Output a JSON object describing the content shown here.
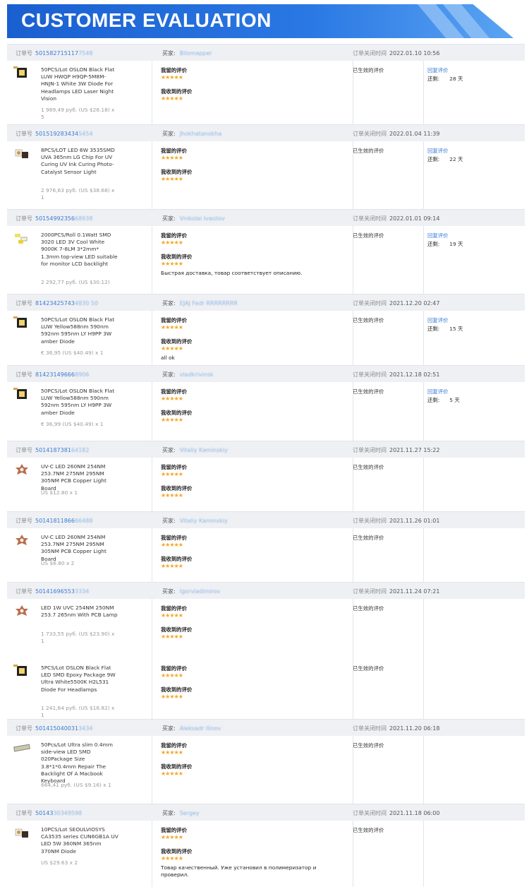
{
  "banner": {
    "title": "CUSTOMER EVALUATION"
  },
  "colors": {
    "accent": "#1a5fd0",
    "star": "#f5a623",
    "link": "#3a7bd5"
  },
  "labels": {
    "order_no": "订单号",
    "buyer": "买家:",
    "close_time": "订单关闭时间",
    "my_review": "我留的评价",
    "received_review": "我收到的评价",
    "status": "已生效的评价",
    "reply": "回复评价",
    "remaining": "还剩:",
    "stars": "★★★★★"
  },
  "orders": [
    {
      "order_id": "501582715117",
      "order_id_blur": "7548",
      "buyer": "Bilomapper",
      "time": "2022.01.10 10:56",
      "remaining": "28 天",
      "items": [
        {
          "name": "50PCS/Lot OSLON Black Flat LUW HWQP H9QP-5M8M-HNJN-1 White 3W Diode For Headlamps LED Laser Night Vision",
          "price": "1 989,49 руб. (US $26.18) x 5",
          "thumb": "black-led-icon",
          "comment": ""
        }
      ]
    },
    {
      "order_id": "501519283434",
      "order_id_blur": "5454",
      "buyer": "Jhokhatanokha",
      "time": "2022.01.04 11:39",
      "remaining": "22 天",
      "items": [
        {
          "name": "8PCS/LOT LED 6W 3535SMD UVA 365nm LG Chip For UV Curing UV Ink Curing Photo-Catalyst Sensor Light",
          "price": "2 976,63 руб. (US $38.68) x 1",
          "thumb": "uv-led-icon",
          "comment": ""
        }
      ]
    },
    {
      "order_id": "50154992356",
      "order_id_blur": "68938",
      "buyer": "Vnikolai Ivasilov",
      "time": "2022.01.01 09:14",
      "remaining": "19 天",
      "items": [
        {
          "name": "2000PCS/Roll 0.1Watt SMD 3020 LED 3V Cool White 9000K 7-8LM 3*2mm* 1.3mm top-view LED suitable for monitor LCD backlight",
          "price": "2 292,77 руб. (US $30.12)",
          "thumb": "smd-strip-icon",
          "comment": "Быстрая доставка, товар соответствует описанию."
        }
      ]
    },
    {
      "order_id": "81423425743",
      "order_id_blur": "4830 50",
      "buyer": "EJAJ Fedr RRRRRRRR",
      "time": "2021.12.20 02:47",
      "remaining": "15 天",
      "items": [
        {
          "name": "50PCS/Lot OSLON Black Flat LUW Yellow588nm 590nm 592nm 595nm LY H9PP 3W amber Diode",
          "price": "€ 36,95 (US $40.49) x 1",
          "thumb": "black-led-icon",
          "comment": "all ok"
        }
      ]
    },
    {
      "order_id": "81423149666",
      "order_id_blur": "8906",
      "buyer": "vladkrivinsk",
      "time": "2021.12.18 02:51",
      "remaining": "5 天",
      "items": [
        {
          "name": "50PCS/Lot OSLON Black Flat LUW Yellow588nm 590nm 592nm 595nm LY H9PP 3W amber Diode",
          "price": "€ 36,99 (US $40.49) x 1",
          "thumb": "black-led-icon",
          "comment": ""
        }
      ]
    },
    {
      "order_id": "5014187381",
      "order_id_blur": "64182",
      "buyer": "Vitaliy Kaminskiy",
      "time": "2021.11.27 15:22",
      "remaining": "",
      "items": [
        {
          "name": "UV-C LED 260NM 254NM 253.7NM 275NM 295NM 305NM PCB Copper Light Board",
          "price": "US $12.80 x 1",
          "thumb": "pcb-star-icon",
          "comment": ""
        }
      ]
    },
    {
      "order_id": "50141811866",
      "order_id_blur": "66488",
      "buyer": "Vitaliy Kaminskiy",
      "time": "2021.11.26 01:01",
      "remaining": "",
      "items": [
        {
          "name": "UV-C LED 260NM 254NM 253.7NM 275NM 295NM 305NM PCB Copper Light Board",
          "price": "US $6.80 x 2",
          "thumb": "pcb-star-icon",
          "comment": ""
        }
      ]
    },
    {
      "order_id": "50141696553",
      "order_id_blur": "3334",
      "buyer": "Igorvladimirov",
      "time": "2021.11.24 07:21",
      "remaining": "",
      "items": [
        {
          "name": "LED 1W UVC 254NM 250NM 253.7 265nm With PCB Lamp",
          "price": "1 733,55 руб. (US $23.90) x 1",
          "thumb": "pcb-star-icon",
          "comment": ""
        },
        {
          "name": "5PCS/Lot OSLON Black Flat LED SMD Epoxy Package 9W Ultra White5500K H2L531 Diode For Headlamps",
          "price": "1 241,64 руб. (US $16.82) x 1",
          "thumb": "black-led-icon",
          "comment": ""
        }
      ]
    },
    {
      "order_id": "501415040031",
      "order_id_blur": "3434",
      "buyer": "Aleksadr Ilinov",
      "time": "2021.11.20 06:18",
      "remaining": "",
      "items": [
        {
          "name": "50Pcs/Lot Ultra slim 0.4mm side-view LED SMD 020Package Size 3.8*1*0.4mm Repair The Backlight Of A Macbook Keyboard",
          "price": "664,41 руб. (US $9.16) x 1",
          "thumb": "slim-led-icon",
          "comment": ""
        }
      ]
    },
    {
      "order_id": "50143",
      "order_id_blur": "30349598",
      "buyer": "Sergey",
      "time": "2021.11.18 06:00",
      "remaining": "",
      "items": [
        {
          "name": "10PCS/Lot SEOULVIOSYS CA3535 series CUN6GB1A UV LED 5W 360NM 365nm 370NM Diode",
          "price": "US $29.63 x 2",
          "thumb": "uv-led-icon",
          "comment": "Товар качественный. Уже установил в полимеризатор и проверил."
        }
      ]
    }
  ]
}
